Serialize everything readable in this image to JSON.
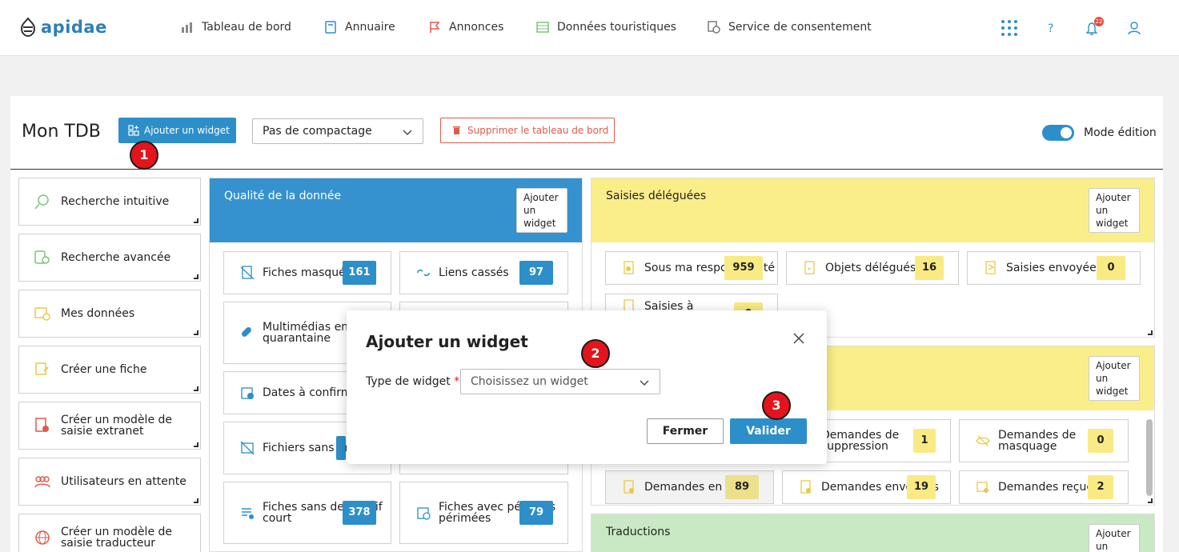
{
  "app": {
    "logo_text": "apidae",
    "brand_color": "#2d8fc9"
  },
  "nav": {
    "items": [
      {
        "label": "Tableau de bord",
        "icon": "dashboard-chart-icon"
      },
      {
        "label": "Annuaire",
        "icon": "book-icon"
      },
      {
        "label": "Annonces",
        "icon": "flag-icon"
      },
      {
        "label": "Données touristiques",
        "icon": "table-data-icon"
      },
      {
        "label": "Service de consentement",
        "icon": "consent-icon"
      }
    ],
    "notifications_count": "22"
  },
  "toolbar": {
    "page_title": "Mon TDB",
    "add_widget_label": "Ajouter un widget",
    "compaction_value": "Pas de compactage",
    "delete_label": "Supprimer le tableau de bord",
    "edit_mode_label": "Mode édition",
    "edit_mode_on": true
  },
  "steps": [
    "1",
    "2",
    "3"
  ],
  "sidebar": {
    "items": [
      {
        "label": "Recherche intuitive",
        "icon": "search-icon"
      },
      {
        "label": "Recherche avancée",
        "icon": "advanced-search-icon"
      },
      {
        "label": "Mes données",
        "icon": "my-data-icon"
      },
      {
        "label": "Créer une fiche",
        "icon": "create-record-icon"
      },
      {
        "label": "Créer un modèle de saisie extranet",
        "icon": "extranet-template-icon"
      },
      {
        "label": "Utilisateurs en attente",
        "icon": "pending-users-icon"
      },
      {
        "label": "Créer un modèle de saisie traducteur",
        "icon": "translator-template-icon"
      }
    ]
  },
  "widgets": {
    "quality": {
      "title": "Qualité de la donnée",
      "add_label": "Ajouter un widget",
      "color": "#3592cf",
      "tiles": [
        {
          "label": "Fiches masquées",
          "count": "161"
        },
        {
          "label": "Liens cassés",
          "count": "97"
        },
        {
          "label": "Multimédias en quarantaine",
          "count": ""
        },
        {
          "label": "Dates à confirmer",
          "count": ""
        },
        {
          "label": "Fichiers sans images",
          "count": ""
        },
        {
          "label": "Fiches sans descriptif court",
          "count": "378"
        },
        {
          "label": "Fiches avec périodes périmées",
          "count": "79"
        }
      ]
    },
    "delegated": {
      "title": "Saisies déléguées",
      "add_label": "Ajouter un widget",
      "color": "#faee8a",
      "tiles": [
        {
          "label": "Sous ma responsabilité",
          "count": "959"
        },
        {
          "label": "Objets délégués",
          "count": "16"
        },
        {
          "label": "Saisies envoyées",
          "count": "0"
        },
        {
          "label": "Saisies à",
          "count": "0"
        }
      ]
    },
    "requests": {
      "title": "",
      "add_label": "Ajouter un widget",
      "color": "#faee8a",
      "tiles": [
        {
          "label": "Demandes de suppression",
          "count": "1"
        },
        {
          "label": "Demandes de masquage",
          "count": "0"
        },
        {
          "label": "Demandes en cours",
          "count": "89"
        },
        {
          "label": "Demandes envoyées",
          "count": "19"
        },
        {
          "label": "Demandes reçues",
          "count": "2"
        }
      ]
    },
    "translations": {
      "title": "Traductions",
      "add_label": "Ajouter un widget",
      "color": "#c9e8c4"
    }
  },
  "modal": {
    "title": "Ajouter un widget",
    "field_label": "Type de widget",
    "required_mark": "*",
    "select_placeholder": "Choisissez un widget",
    "close_label": "Fermer",
    "submit_label": "Valider"
  }
}
